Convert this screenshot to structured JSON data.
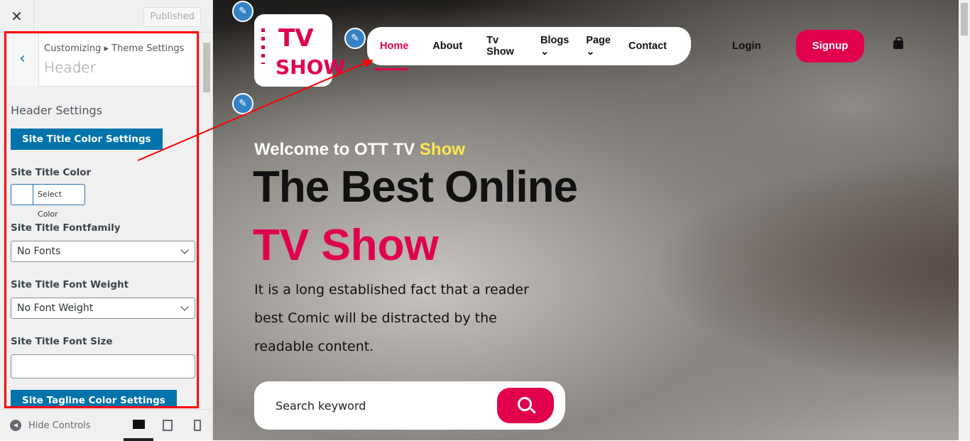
{
  "customizer": {
    "close_icon": "close-icon",
    "publish_label": "Published",
    "breadcrumb": "Customizing ▸ Theme Settings",
    "section_title": "Header",
    "heading": "Header Settings",
    "site_title_color_btn": "Site Title Color Settings",
    "site_title_color_label": "Site Title Color",
    "select_color": "Select Color",
    "fontfamily_label": "Site Title Fontfamily",
    "fontfamily_value": "No Fonts",
    "fontweight_label": "Site Title Font Weight",
    "fontweight_value": "No Font Weight",
    "fontsize_label": "Site Title Font Size",
    "fontsize_value": "",
    "tagline_btn": "Site Tagline Color Settings",
    "hide_controls": "Hide Controls",
    "accent": "#0073aa"
  },
  "preview": {
    "logo_text": "TV SHOW",
    "nav": [
      "Home",
      "About",
      "Tv Show",
      "Blogs",
      "Page",
      "Contact"
    ],
    "active": "Home",
    "login": "Login",
    "signup": "Signup",
    "welcome": "Welcome to OTT TV ",
    "welcome_highlight": "Show",
    "headline1": "The Best Online",
    "headline2": "TV Show",
    "description": "It is a long established fact that a reader best Comic will be distracted by the readable content.",
    "search_placeholder": "Search keyword",
    "brand_color": "#e0004d"
  }
}
